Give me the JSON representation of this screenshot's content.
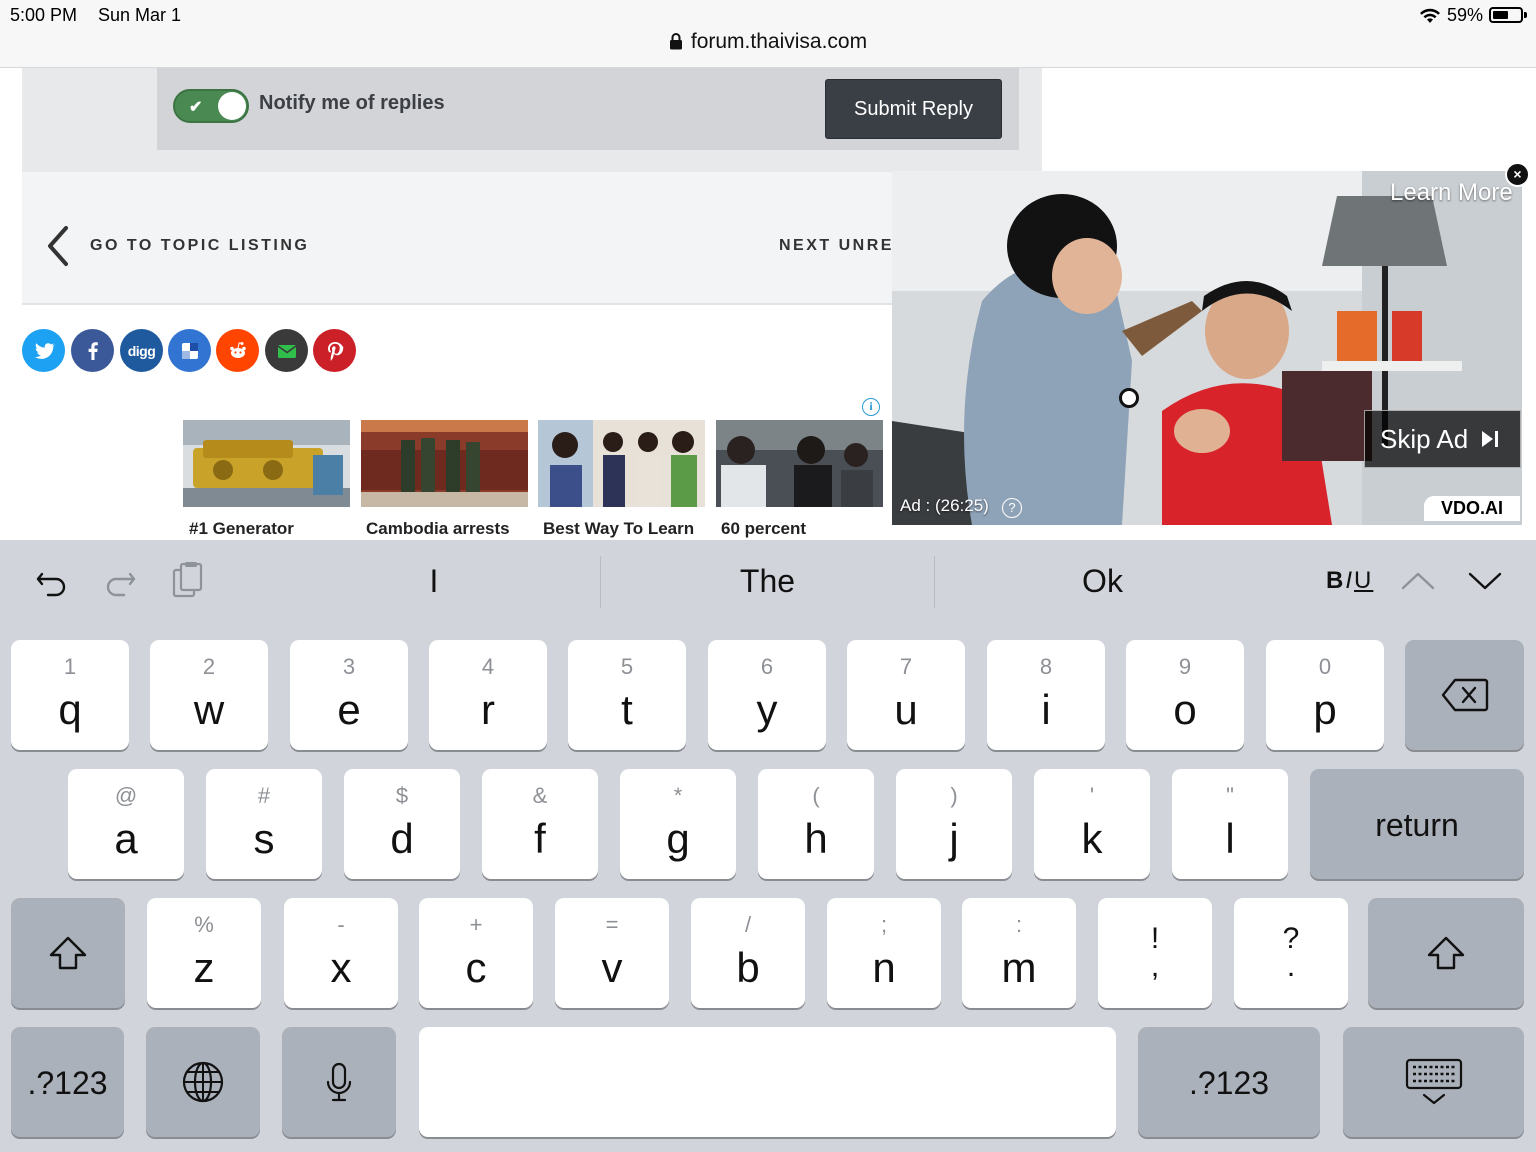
{
  "status_bar": {
    "time": "5:00 PM",
    "date": "Sun Mar 1",
    "battery_percent": "59%",
    "battery_level": 0.59
  },
  "browser": {
    "url": "forum.thaivisa.com"
  },
  "reply": {
    "notify_label": "Notify me of replies",
    "notify_enabled": true,
    "submit_label": "Submit Reply"
  },
  "topic_nav": {
    "go_to_topic": "GO TO TOPIC LISTING",
    "next_unread": "NEXT UNREAD"
  },
  "share_buttons": [
    {
      "name": "twitter",
      "color": "#1da1f2"
    },
    {
      "name": "facebook",
      "color": "#3b5998"
    },
    {
      "name": "digg",
      "color": "#1f5a9e",
      "text": "digg"
    },
    {
      "name": "delicious",
      "color": "#3274d1"
    },
    {
      "name": "reddit",
      "color": "#ff4500"
    },
    {
      "name": "email",
      "color": "#3a3a3a"
    },
    {
      "name": "pinterest",
      "color": "#cb2027"
    }
  ],
  "sponsored": {
    "items": [
      {
        "caption": "#1 Generator"
      },
      {
        "caption": "Cambodia arrests"
      },
      {
        "caption": "Best Way To Learn"
      },
      {
        "caption": "60 percent"
      }
    ]
  },
  "video_ad": {
    "learn_more": "Learn More",
    "skip_ad": "Skip Ad",
    "ad_time": "Ad : (26:25)",
    "brand": "VDO.AI",
    "close_icon": "×"
  },
  "keyboard": {
    "suggestions": [
      "I",
      "The",
      "Ok"
    ],
    "format_label": "BIU",
    "row1": [
      {
        "hint": "1",
        "main": "q"
      },
      {
        "hint": "2",
        "main": "w"
      },
      {
        "hint": "3",
        "main": "e"
      },
      {
        "hint": "4",
        "main": "r"
      },
      {
        "hint": "5",
        "main": "t"
      },
      {
        "hint": "6",
        "main": "y"
      },
      {
        "hint": "7",
        "main": "u"
      },
      {
        "hint": "8",
        "main": "i"
      },
      {
        "hint": "9",
        "main": "o"
      },
      {
        "hint": "0",
        "main": "p"
      }
    ],
    "row2": [
      {
        "hint": "@",
        "main": "a"
      },
      {
        "hint": "#",
        "main": "s"
      },
      {
        "hint": "$",
        "main": "d"
      },
      {
        "hint": "&",
        "main": "f"
      },
      {
        "hint": "*",
        "main": "g"
      },
      {
        "hint": "(",
        "main": "h"
      },
      {
        "hint": ")",
        "main": "j"
      },
      {
        "hint": "'",
        "main": "k"
      },
      {
        "hint": "\"",
        "main": "l"
      }
    ],
    "return_label": "return",
    "row3": [
      {
        "hint": "%",
        "main": "z"
      },
      {
        "hint": "-",
        "main": "x"
      },
      {
        "hint": "+",
        "main": "c"
      },
      {
        "hint": "=",
        "main": "v"
      },
      {
        "hint": "/",
        "main": "b"
      },
      {
        "hint": ";",
        "main": "n"
      },
      {
        "hint": ":",
        "main": "m"
      },
      {
        "hint": "!",
        "main": ","
      },
      {
        "hint": "?",
        "main": "."
      }
    ],
    "numbers_label": ".?123"
  }
}
